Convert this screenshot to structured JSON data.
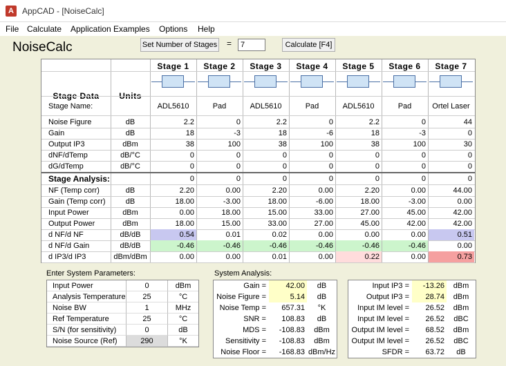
{
  "window": {
    "title": "AppCAD - [NoiseCalc]"
  },
  "menu": {
    "items": [
      "File",
      "Calculate",
      "Application Examples",
      "Options",
      "Help"
    ]
  },
  "toolbar": {
    "page_title": "NoiseCalc",
    "set_stages_label": "Set Number of Stages",
    "equals": "=",
    "stages_value": "7",
    "calculate_label": "Calculate [F4]"
  },
  "grid": {
    "header_label": "Stage Data",
    "units_header": "Units",
    "stages": [
      "Stage 1",
      "Stage 2",
      "Stage 3",
      "Stage 4",
      "Stage 5",
      "Stage 6",
      "Stage 7"
    ],
    "stage_name_label": "Stage Name:",
    "stage_names": [
      "ADL5610",
      "Pad",
      "ADL5610",
      "Pad",
      "ADL5610",
      "Pad",
      "Ortel Laser"
    ],
    "input_rows": [
      {
        "label": "Noise Figure",
        "unit": "dB",
        "values": [
          "2.2",
          "0",
          "2.2",
          "0",
          "2.2",
          "0",
          "44"
        ]
      },
      {
        "label": "Gain",
        "unit": "dB",
        "values": [
          "18",
          "-3",
          "18",
          "-6",
          "18",
          "-3",
          "0"
        ]
      },
      {
        "label": "Output IP3",
        "unit": "dBm",
        "values": [
          "38",
          "100",
          "38",
          "100",
          "38",
          "100",
          "30"
        ]
      },
      {
        "label": "dNF/dTemp",
        "unit": "dB/°C",
        "values": [
          "0",
          "0",
          "0",
          "0",
          "0",
          "0",
          "0"
        ]
      },
      {
        "label": "dG/dTemp",
        "unit": "dB/°C",
        "values": [
          "0",
          "0",
          "0",
          "0",
          "0",
          "0",
          "0"
        ]
      }
    ],
    "analysis_label": "Stage Analysis:",
    "analysis_zero": [
      "0",
      "0",
      "0",
      "0",
      "0",
      "0",
      "0"
    ],
    "analysis_rows": [
      {
        "label": "NF (Temp corr)",
        "unit": "dB",
        "values": [
          "2.20",
          "0.00",
          "2.20",
          "0.00",
          "2.20",
          "0.00",
          "44.00"
        ]
      },
      {
        "label": "Gain (Temp corr)",
        "unit": "dB",
        "values": [
          "18.00",
          "-3.00",
          "18.00",
          "-6.00",
          "18.00",
          "-3.00",
          "0.00"
        ]
      },
      {
        "label": "Input Power",
        "unit": "dBm",
        "values": [
          "0.00",
          "18.00",
          "15.00",
          "33.00",
          "27.00",
          "45.00",
          "42.00"
        ]
      },
      {
        "label": "Output Power",
        "unit": "dBm",
        "values": [
          "18.00",
          "15.00",
          "33.00",
          "27.00",
          "45.00",
          "42.00",
          "42.00"
        ]
      },
      {
        "label": "d NF/d NF",
        "unit": "dB/dB",
        "values": [
          "0.54",
          "0.01",
          "0.02",
          "0.00",
          "0.00",
          "0.00",
          "0.51"
        ]
      },
      {
        "label": "d NF/d Gain",
        "unit": "dB/dB",
        "values": [
          "-0.46",
          "-0.46",
          "-0.46",
          "-0.46",
          "-0.46",
          "-0.46",
          "0.00"
        ]
      },
      {
        "label": "d IP3/d IP3",
        "unit": "dBm/dBm",
        "values": [
          "0.00",
          "0.00",
          "0.01",
          "0.00",
          "0.22",
          "0.00",
          "0.73"
        ]
      }
    ],
    "highlight_colors": {
      "blue": "#c8c8f0",
      "green": "#ccf5cc",
      "pink": "#ffdcdc",
      "red": "#f5a0a0"
    }
  },
  "system_params": {
    "title": "Enter System Parameters:",
    "rows": [
      {
        "label": "Input Power",
        "value": "0",
        "unit": "dBm"
      },
      {
        "label": "Analysis Temperature",
        "value": "25",
        "unit": "°C"
      },
      {
        "label": "Noise BW",
        "value": "1",
        "unit": "MHz"
      },
      {
        "label": "Ref Temperature",
        "value": "25",
        "unit": "°C"
      },
      {
        "label": "S/N (for sensitivity)",
        "value": "0",
        "unit": "dB"
      },
      {
        "label": "Noise Source (Ref)",
        "value": "290",
        "unit": "°K"
      }
    ]
  },
  "system_analysis": {
    "title": "System Analysis:",
    "left": [
      {
        "label": "Gain =",
        "value": "42.00",
        "unit": "dB"
      },
      {
        "label": "Noise Figure =",
        "value": "5.14",
        "unit": "dB"
      },
      {
        "label": "Noise Temp =",
        "value": "657.31",
        "unit": "°K"
      },
      {
        "label": "SNR =",
        "value": "108.83",
        "unit": "dB"
      },
      {
        "label": "MDS =",
        "value": "-108.83",
        "unit": "dBm"
      },
      {
        "label": "Sensitivity =",
        "value": "-108.83",
        "unit": "dBm"
      },
      {
        "label": "Noise Floor =",
        "value": "-168.83",
        "unit": "dBm/Hz"
      }
    ],
    "right": [
      {
        "label": "Input IP3 =",
        "value": "-13.26",
        "unit": "dBm"
      },
      {
        "label": "Output IP3 =",
        "value": "28.74",
        "unit": "dBm"
      },
      {
        "label": "Input IM level =",
        "value": "26.52",
        "unit": "dBm"
      },
      {
        "label": "Input IM level =",
        "value": "26.52",
        "unit": "dBC"
      },
      {
        "label": "Output IM level =",
        "value": "68.52",
        "unit": "dBm"
      },
      {
        "label": "Output IM level =",
        "value": "26.52",
        "unit": "dBC"
      },
      {
        "label": "SFDR =",
        "value": "63.72",
        "unit": "dB"
      }
    ]
  }
}
